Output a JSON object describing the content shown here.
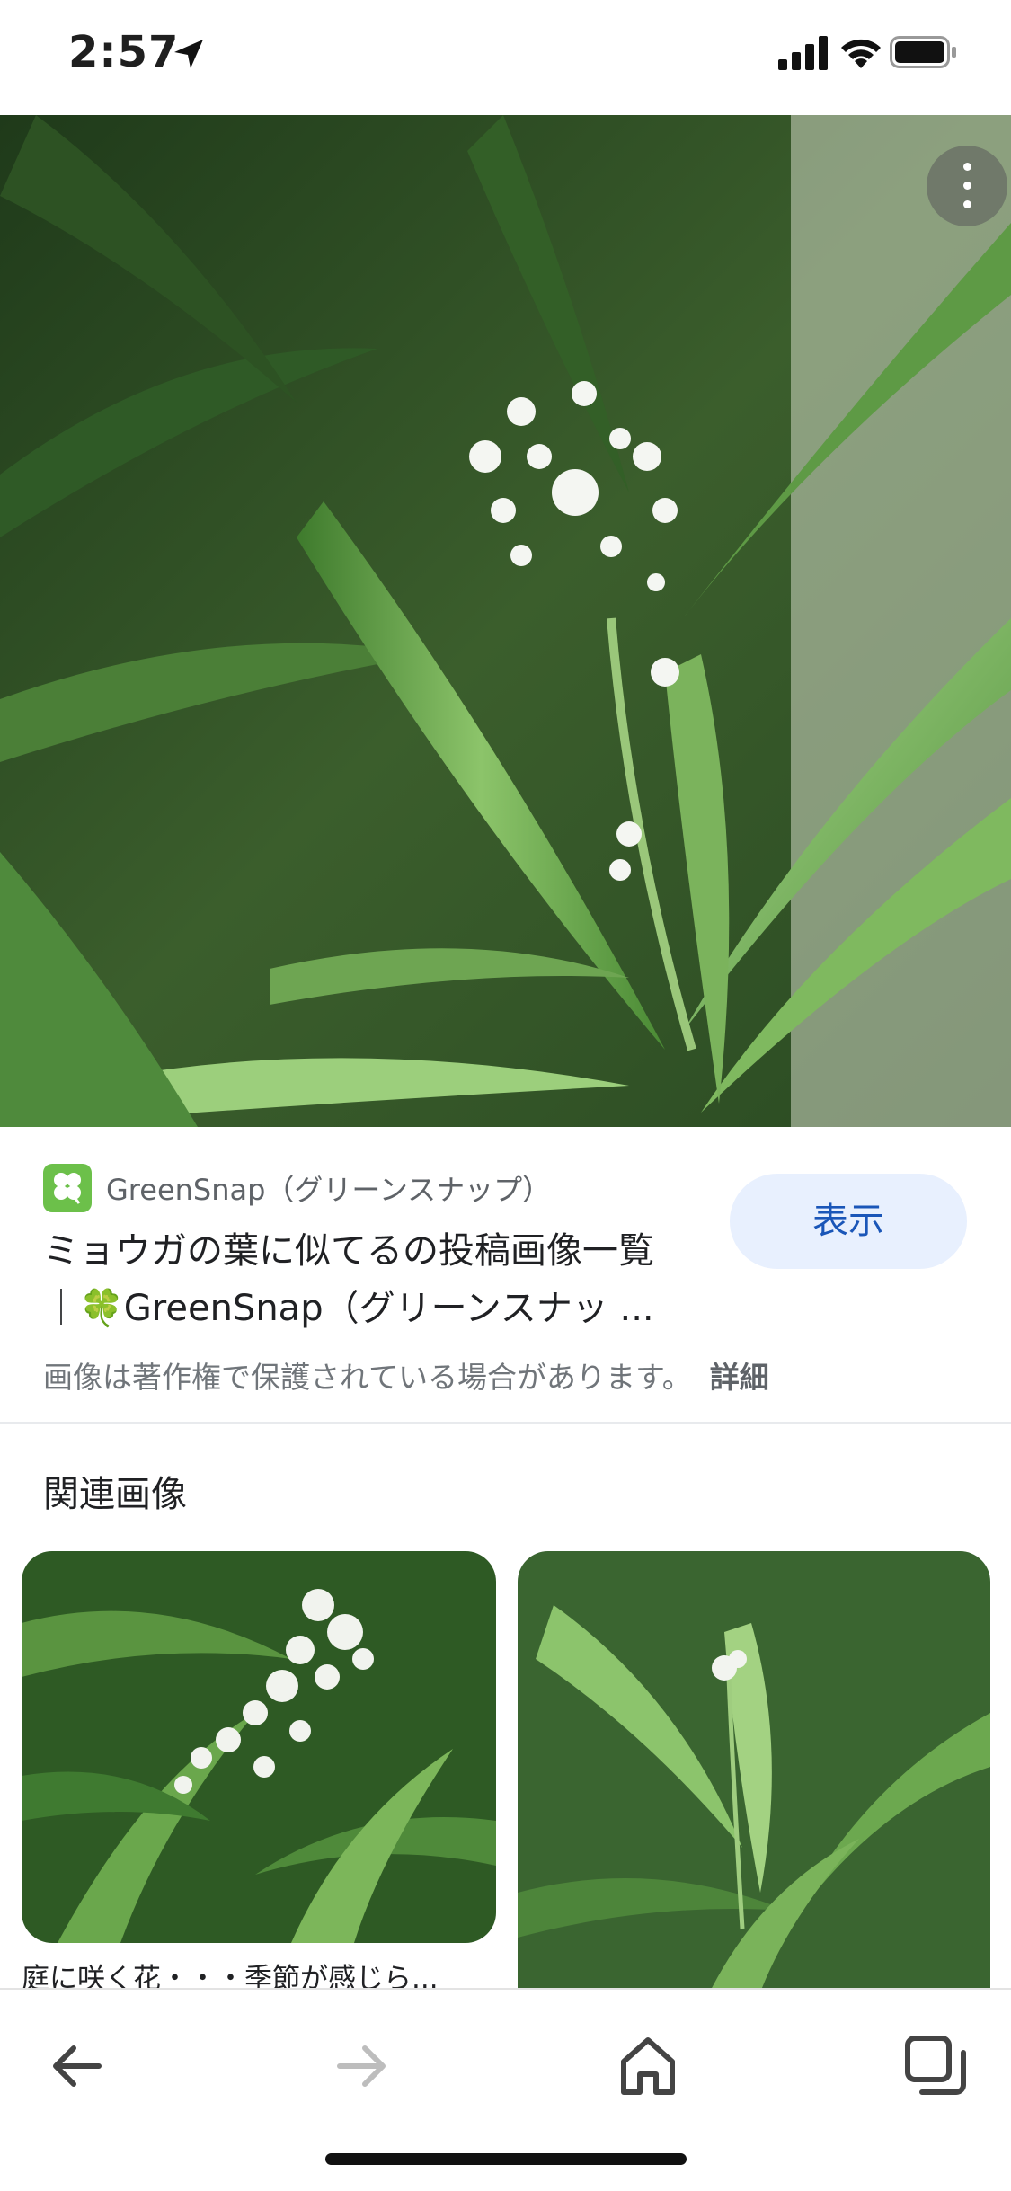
{
  "status_bar": {
    "time": "2:57",
    "icons": [
      "location-arrow-icon",
      "signal-icon",
      "wifi-icon",
      "battery-icon"
    ]
  },
  "hero_image": {
    "description_icon": "plant-photo",
    "menu_icon": "more-vert-icon"
  },
  "result": {
    "source_name": "GreenSnap（グリーンスナップ）",
    "title_line1": "ミョウガの葉に似てるの投稿画像一覧",
    "title_line2": "｜🍀GreenSnap（グリーンスナッ ...",
    "view_button": "表示",
    "copyright_notice": "画像は著作権で保護されている場合があります。",
    "details_link": "詳細"
  },
  "related": {
    "heading": "関連画像",
    "items": [
      {
        "caption": "庭に咲く花・・・季節が感じら..."
      },
      {
        "caption": ""
      }
    ]
  },
  "bottom_nav": {
    "icons": [
      "back-icon",
      "forward-icon",
      "home-icon",
      "tabs-icon"
    ]
  },
  "colors": {
    "accent": "#1a56b8",
    "button_bg": "#e8f0fe",
    "logo_green": "#6cc04a"
  }
}
